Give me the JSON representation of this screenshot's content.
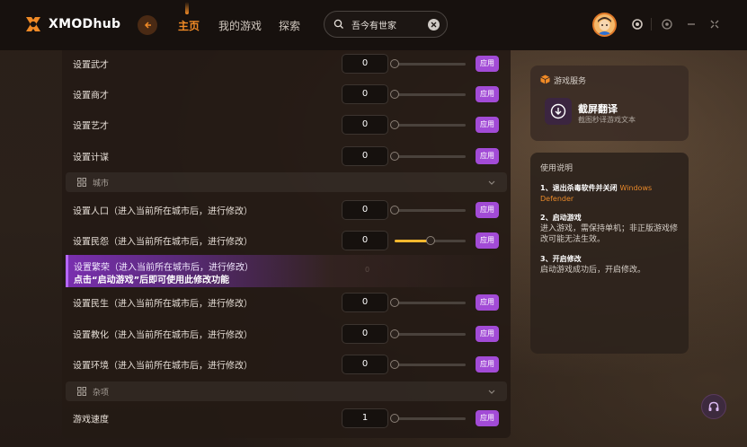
{
  "app": {
    "name": "XMODhub"
  },
  "nav": {
    "items": [
      {
        "label": "主页",
        "active": true
      },
      {
        "label": "我的游戏",
        "active": false
      },
      {
        "label": "探索",
        "active": false
      }
    ]
  },
  "search": {
    "value": "吾今有世家"
  },
  "rows_top": [
    {
      "label": "设置武才",
      "value": "0",
      "slider": 0
    },
    {
      "label": "设置商才",
      "value": "0",
      "slider": 0
    },
    {
      "label": "设置艺才",
      "value": "0",
      "slider": 0
    },
    {
      "label": "设置计谋",
      "value": "0",
      "slider": 0
    }
  ],
  "apply_label": "应用",
  "sections": {
    "city": "城市",
    "misc": "杂项"
  },
  "rows_city": [
    {
      "label": "设置人口（进入当前所在城市后，进行修改）",
      "value": "0",
      "slider": 0
    },
    {
      "label": "设置民怨（进入当前所在城市后，进行修改）",
      "value": "0",
      "slider": 0.5
    }
  ],
  "locked_row": {
    "label": "设置繁荣（进入当前所在城市后，进行修改）",
    "notice": "点击“启动游戏”后即可使用此修改功能",
    "dim_value": "0"
  },
  "rows_city2": [
    {
      "label": "设置民生（进入当前所在城市后，进行修改）",
      "value": "0",
      "slider": 0
    },
    {
      "label": "设置教化（进入当前所在城市后，进行修改）",
      "value": "0",
      "slider": 0
    },
    {
      "label": "设置环境（进入当前所在城市后，进行修改）",
      "value": "0",
      "slider": 0
    }
  ],
  "rows_misc": [
    {
      "label": "游戏速度",
      "value": "1",
      "slider": 0
    }
  ],
  "service": {
    "title": "游戏服务",
    "item_name": "截屏翻译",
    "item_desc": "截图秒译游戏文本"
  },
  "help": {
    "title": "使用说明",
    "step1_title": "1、退出杀毒软件并关闭",
    "step1_highlight": "Windows Defender",
    "step2_title": "2、启动游戏",
    "step2_text": "进入游戏，需保持单机；非正版游戏修改可能无法生效。",
    "step3_title": "3、开启修改",
    "step3_text": "启动游戏成功后，开启修改。"
  },
  "colors": {
    "accent": "#f08a26",
    "apply": "#a24bd6",
    "slider_fill": "#f5b82e"
  }
}
